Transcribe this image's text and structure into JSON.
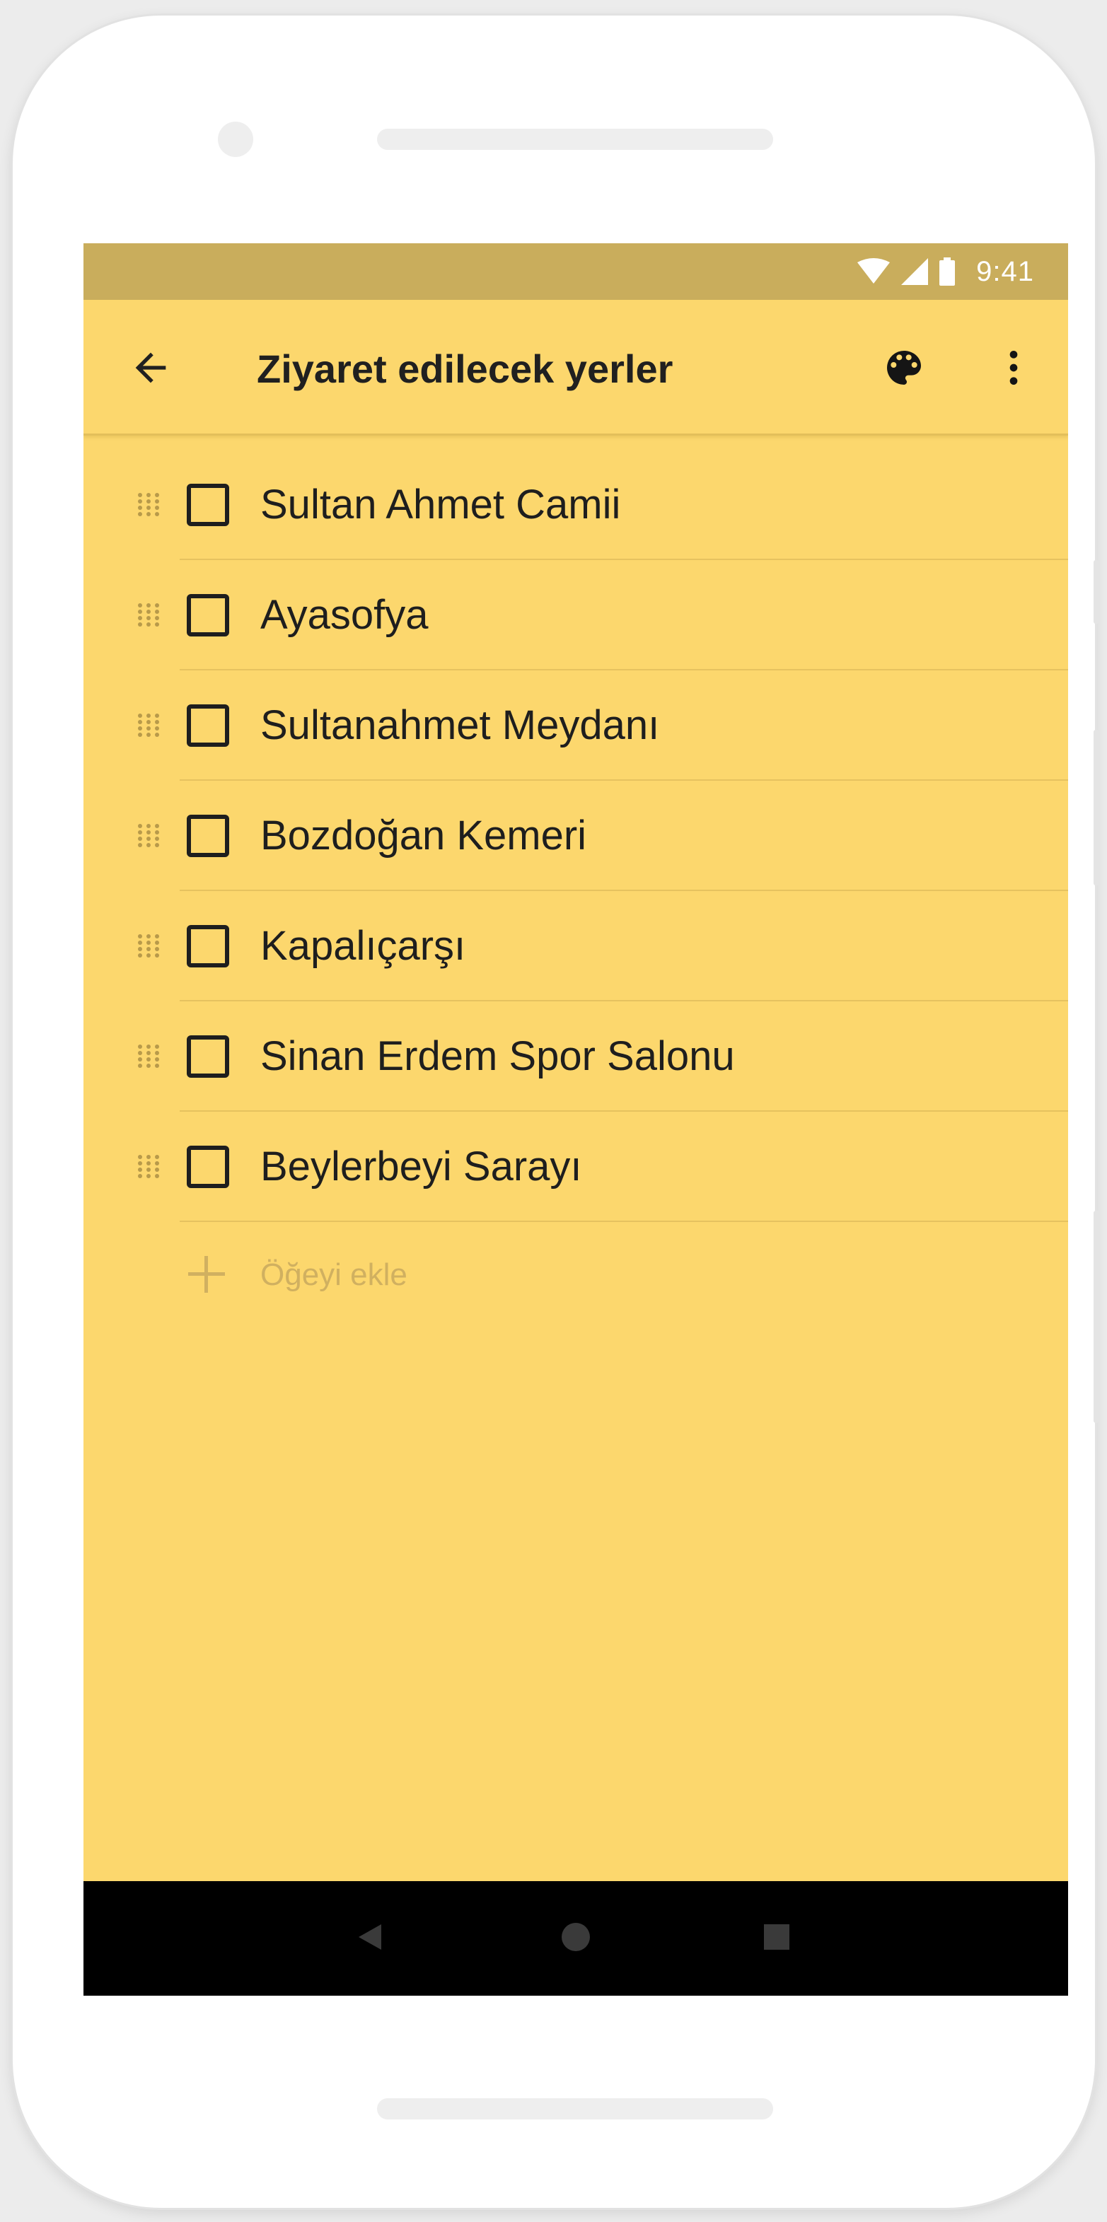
{
  "status_bar": {
    "time": "9:41",
    "icons": [
      "wifi-icon",
      "cellular-signal-icon",
      "battery-icon"
    ]
  },
  "toolbar": {
    "title": "Ziyaret edilecek yerler",
    "back_icon": "arrow-back-icon",
    "palette_icon": "palette-icon",
    "more_icon": "more-vertical-icon"
  },
  "checklist": {
    "items": [
      {
        "label": "Sultan Ahmet Camii",
        "checked": false
      },
      {
        "label": "Ayasofya",
        "checked": false
      },
      {
        "label": "Sultanahmet Meydanı",
        "checked": false
      },
      {
        "label": "Bozdoğan Kemeri",
        "checked": false
      },
      {
        "label": "Kapalıçarşı",
        "checked": false
      },
      {
        "label": "Sinan Erdem Spor Salonu",
        "checked": false
      },
      {
        "label": "Beylerbeyi Sarayı",
        "checked": false
      }
    ],
    "add_item_placeholder": "Öğeyi ekle"
  },
  "nav_bar": {
    "icons": [
      "nav-back-icon",
      "nav-home-icon",
      "nav-recents-icon"
    ]
  },
  "colors": {
    "note_background": "#fcd76d",
    "status_bar": "#c9ad5c",
    "text": "#1e1e1e",
    "placeholder": "#d0b060",
    "nav_bar": "#000000"
  }
}
